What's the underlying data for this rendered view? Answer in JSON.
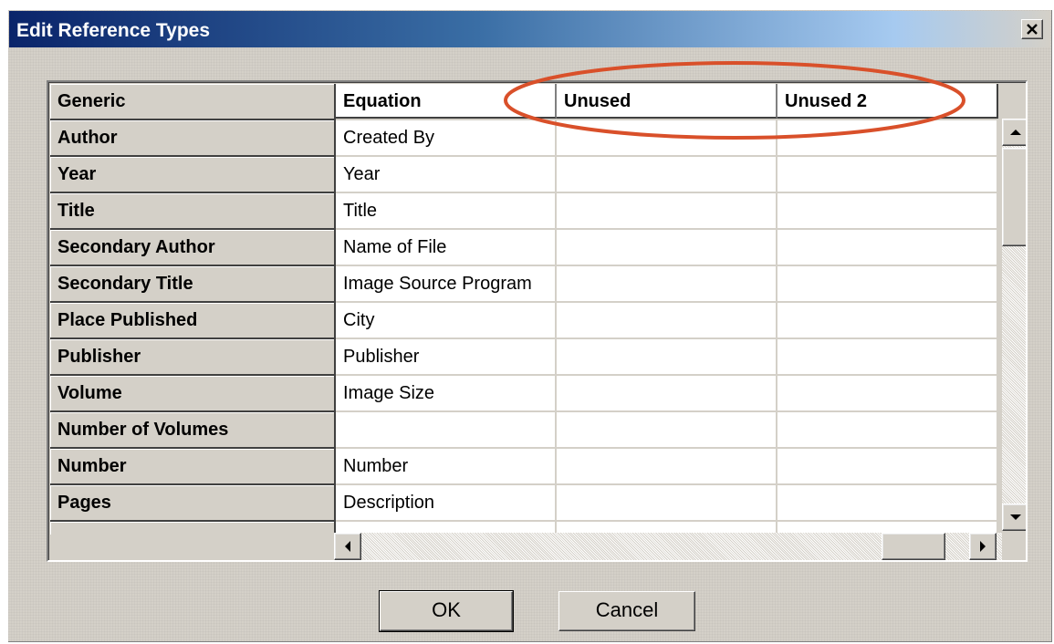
{
  "window": {
    "title": "Edit Reference Types",
    "close_icon": "close-icon"
  },
  "grid": {
    "headers": {
      "generic": "Generic",
      "columns": [
        "Equation",
        "Unused",
        "Unused 2"
      ]
    },
    "rows": [
      {
        "field": "Author",
        "values": [
          "Created By",
          "",
          ""
        ]
      },
      {
        "field": "Year",
        "values": [
          "Year",
          "",
          ""
        ]
      },
      {
        "field": "Title",
        "values": [
          "Title",
          "",
          ""
        ]
      },
      {
        "field": "Secondary Author",
        "values": [
          "Name of File",
          "",
          ""
        ]
      },
      {
        "field": "Secondary Title",
        "values": [
          "Image Source Program",
          "",
          ""
        ]
      },
      {
        "field": "Place Published",
        "values": [
          "City",
          "",
          ""
        ]
      },
      {
        "field": "Publisher",
        "values": [
          "Publisher",
          "",
          ""
        ]
      },
      {
        "field": "Volume",
        "values": [
          "Image Size",
          "",
          ""
        ]
      },
      {
        "field": "Number of Volumes",
        "values": [
          "",
          "",
          ""
        ]
      },
      {
        "field": "Number",
        "values": [
          "Number",
          "",
          ""
        ]
      },
      {
        "field": "Pages",
        "values": [
          "Description",
          "",
          ""
        ]
      }
    ]
  },
  "buttons": {
    "ok": "OK",
    "cancel": "Cancel"
  },
  "annotation": {
    "highlight_color": "#d9502a"
  }
}
